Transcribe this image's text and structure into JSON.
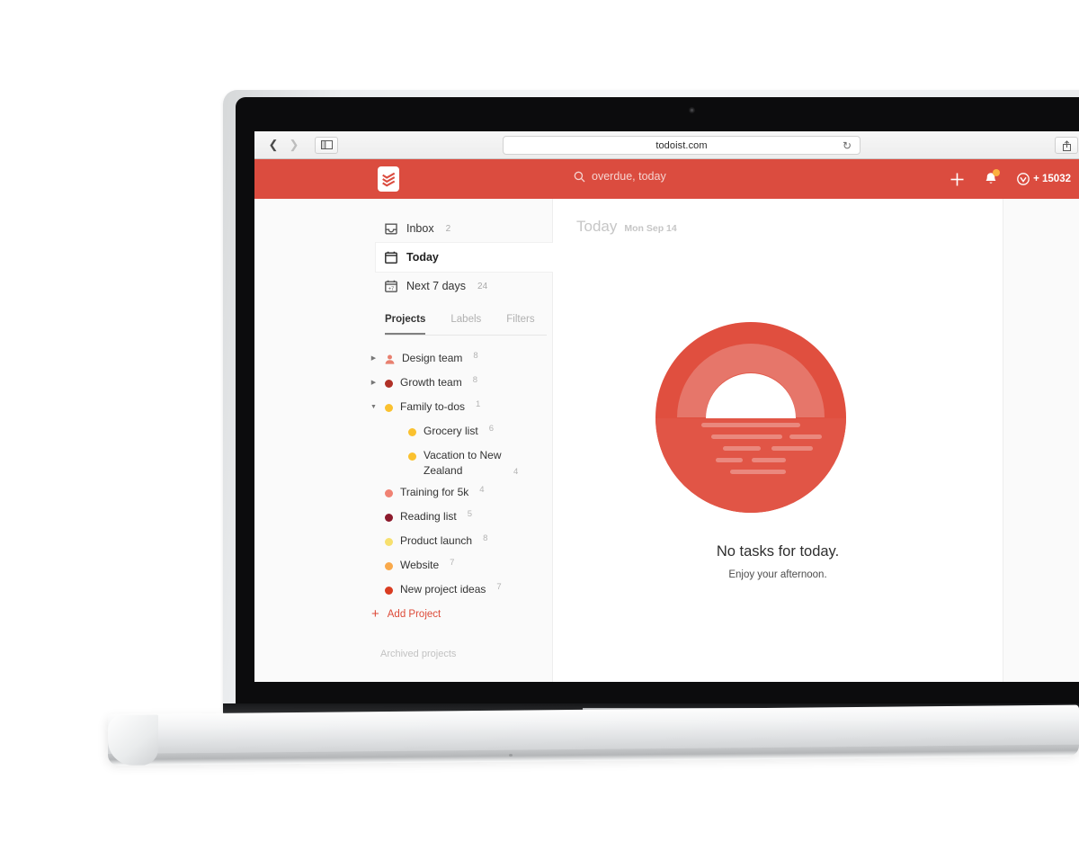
{
  "browser": {
    "back_icon": "chevron-left-icon",
    "forward_icon": "chevron-right-icon",
    "sidebar_toggle_icon": "sidebar-icon",
    "url": "todoist.com",
    "reload_icon": "reload-icon",
    "share_icon": "share-icon",
    "tabs_icon": "tabs-icon"
  },
  "app_header": {
    "logo_icon": "todoist-logo-icon",
    "search_icon": "search-icon",
    "search_placeholder": "overdue, today",
    "add_icon": "plus-icon",
    "notifications_icon": "bell-icon",
    "karma_icon": "karma-icon",
    "karma_points": "+ 15032",
    "settings_icon": "gear-icon",
    "background_color": "#db4c3f"
  },
  "sidebar": {
    "nav": [
      {
        "label": "Inbox",
        "count": "2",
        "icon": "inbox-icon",
        "selected": false
      },
      {
        "label": "Today",
        "count": "",
        "icon": "calendar-icon",
        "selected": true
      },
      {
        "label": "Next 7 days",
        "count": "24",
        "icon": "calendar-7-icon",
        "selected": false
      }
    ],
    "tabs": [
      {
        "label": "Projects",
        "active": true
      },
      {
        "label": "Labels",
        "active": false
      },
      {
        "label": "Filters",
        "active": false
      }
    ],
    "projects": [
      {
        "label": "Design team",
        "count": "8",
        "color": "#e8806f",
        "arrow": "collapsed",
        "shared": true,
        "child": false
      },
      {
        "label": "Growth team",
        "count": "8",
        "color": "#b03127",
        "arrow": "collapsed",
        "shared": false,
        "child": false
      },
      {
        "label": "Family to-dos",
        "count": "1",
        "color": "#fac12f",
        "arrow": "expanded",
        "shared": false,
        "child": false
      },
      {
        "label": "Grocery list",
        "count": "6",
        "color": "#fac12f",
        "arrow": "none",
        "shared": false,
        "child": true
      },
      {
        "label": "Vacation to New Zealand",
        "count": "4",
        "color": "#fac12f",
        "arrow": "none",
        "shared": false,
        "child": true
      },
      {
        "label": "Training for 5k",
        "count": "4",
        "color": "#f08273",
        "arrow": "none",
        "shared": false,
        "child": false
      },
      {
        "label": "Reading list",
        "count": "5",
        "color": "#8c1a2c",
        "arrow": "none",
        "shared": false,
        "child": false
      },
      {
        "label": "Product launch",
        "count": "8",
        "color": "#f7e06e",
        "arrow": "none",
        "shared": false,
        "child": false
      },
      {
        "label": "Website",
        "count": "7",
        "color": "#f9a94b",
        "arrow": "none",
        "shared": false,
        "child": false
      },
      {
        "label": "New project ideas",
        "count": "7",
        "color": "#d93c21",
        "arrow": "none",
        "shared": false,
        "child": false
      }
    ],
    "add_project_label": "Add Project",
    "add_project_icon": "plus-icon",
    "archived_label": "Archived projects"
  },
  "content": {
    "title": "Today",
    "date": "Mon Sep 14",
    "illustration": "sunset-icon",
    "empty_title": "No tasks for today.",
    "empty_subtitle": "Enjoy your afternoon."
  },
  "colors": {
    "brand_red": "#db4c3f",
    "illustration_red": "#e04f3f",
    "sidebar_bg": "#fafafa"
  }
}
